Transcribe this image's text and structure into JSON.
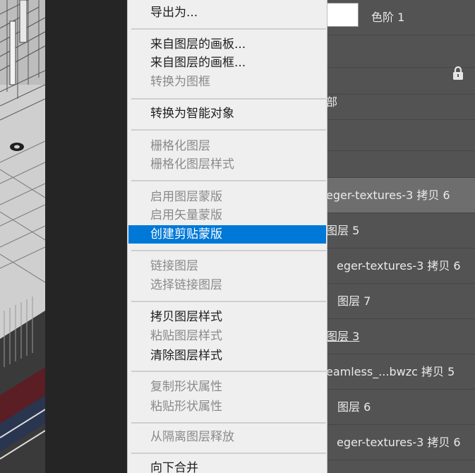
{
  "context_menu": {
    "items": [
      {
        "label": "导出为...",
        "state": "enabled"
      },
      {
        "label": "来自图层的画板...",
        "state": "enabled"
      },
      {
        "label": "来自图层的画框...",
        "state": "enabled"
      },
      {
        "label": "转换为图框",
        "state": "disabled"
      },
      {
        "label": "转换为智能对象",
        "state": "enabled"
      },
      {
        "label": "栅格化图层",
        "state": "disabled"
      },
      {
        "label": "栅格化图层样式",
        "state": "disabled"
      },
      {
        "label": "启用图层蒙版",
        "state": "disabled"
      },
      {
        "label": "启用矢量蒙版",
        "state": "disabled"
      },
      {
        "label": "创建剪贴蒙版",
        "state": "highlighted"
      },
      {
        "label": "链接图层",
        "state": "disabled"
      },
      {
        "label": "选择链接图层",
        "state": "disabled"
      },
      {
        "label": "拷贝图层样式",
        "state": "enabled"
      },
      {
        "label": "粘贴图层样式",
        "state": "disabled"
      },
      {
        "label": "清除图层样式",
        "state": "enabled"
      },
      {
        "label": "复制形状属性",
        "state": "disabled"
      },
      {
        "label": "粘贴形状属性",
        "state": "disabled"
      },
      {
        "label": "从隔离图层释放",
        "state": "disabled"
      },
      {
        "label": "向下合并",
        "state": "enabled"
      }
    ]
  },
  "layers_panel": {
    "rows": [
      {
        "name": "色阶 1",
        "has_mask_thumb": true
      },
      {
        "name": ""
      },
      {
        "name": "",
        "locked": true
      },
      {
        "name": "部"
      },
      {
        "name": ""
      },
      {
        "name": "eger-textures-3 拷贝 6",
        "selected": true
      },
      {
        "name": "图层 5"
      },
      {
        "name": "eger-textures-3 拷贝 6"
      },
      {
        "name": "图层 7"
      },
      {
        "name": "图层 3",
        "underlined": true
      },
      {
        "name": "eamless_...bwzc 拷贝 5"
      },
      {
        "name": "图层 6"
      },
      {
        "name": "eger-textures-3 拷贝 6"
      }
    ]
  },
  "icons": {
    "lock": "lock-icon"
  },
  "colors": {
    "menu_highlight": "#0078d7",
    "panel_bg": "#535353",
    "menu_bg": "#efefef"
  }
}
